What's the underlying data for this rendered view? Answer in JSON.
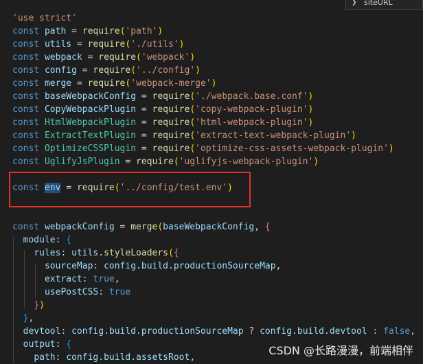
{
  "find_widget": {
    "chevron_icon": "chevron-right-icon",
    "value": "siteURL"
  },
  "code": {
    "l1": {
      "s": "'use strict'"
    },
    "l2": {
      "kw": "const",
      "v": "path",
      "eq": " = ",
      "fn": "require",
      "o": "(",
      "s": "'path'",
      "c": ")"
    },
    "l3": {
      "kw": "const",
      "v": "utils",
      "eq": " = ",
      "fn": "require",
      "o": "(",
      "s": "'./utils'",
      "c": ")"
    },
    "l4": {
      "kw": "const",
      "v": "webpack",
      "eq": " = ",
      "fn": "require",
      "o": "(",
      "s": "'webpack'",
      "c": ")"
    },
    "l5": {
      "kw": "const",
      "v": "config",
      "eq": " = ",
      "fn": "require",
      "o": "(",
      "s": "'../config'",
      "c": ")"
    },
    "l6": {
      "kw": "const",
      "v": "merge",
      "eq": " = ",
      "fn": "require",
      "o": "(",
      "s": "'webpack-merge'",
      "c": ")"
    },
    "l7": {
      "kw": "const",
      "v": "baseWebpackConfig",
      "eq": " = ",
      "fn": "require",
      "o": "(",
      "s": "'./webpack.base.conf'",
      "c": ")"
    },
    "l8": {
      "kw": "const",
      "v": "CopyWebpackPlugin",
      "eq": " = ",
      "fn": "require",
      "o": "(",
      "s": "'copy-webpack-plugin'",
      "c": ")"
    },
    "l9": {
      "kw": "const",
      "v": "HtmlWebpackPlugin",
      "eq": " = ",
      "fn": "require",
      "o": "(",
      "s": "'html-webpack-plugin'",
      "c": ")"
    },
    "l10": {
      "kw": "const",
      "v": "ExtractTextPlugin",
      "eq": " = ",
      "fn": "require",
      "o": "(",
      "s": "'extract-text-webpack-plugin'",
      "c": ")"
    },
    "l11": {
      "kw": "const",
      "v": "OptimizeCSSPlugin",
      "eq": " = ",
      "fn": "require",
      "o": "(",
      "s": "'optimize-css-assets-webpack-plugin'",
      "c": ")"
    },
    "l12": {
      "kw": "const",
      "v": "UglifyJsPlugin",
      "eq": " = ",
      "fn": "require",
      "o": "(",
      "s": "'uglifyjs-webpack-plugin'",
      "c": ")"
    },
    "l14": {
      "kw": "const",
      "v": "env",
      "eq": " = ",
      "fn": "require",
      "o": "(",
      "s": "'../config/test.env'",
      "c": ")"
    },
    "l17": {
      "kw": "const",
      "v": "webpackConfig",
      "eq": " = ",
      "fn": "merge",
      "o": "(",
      "arg": "baseWebpackConfig",
      "comma": ", ",
      "b": "{"
    },
    "l18": {
      "indent": "  ",
      "k": "module",
      "colon": ": ",
      "b": "{"
    },
    "l19": {
      "indent": "    ",
      "k": "rules",
      "colon": ": ",
      "obj": "utils",
      "dot": ".",
      "fn": "styleLoaders",
      "o": "(",
      "b": "{"
    },
    "l20": {
      "indent": "      ",
      "k": "sourceMap",
      "colon": ": ",
      "a": "config",
      "d1": ".",
      "b2": "build",
      "d2": ".",
      "c2": "productionSourceMap",
      "comma": ","
    },
    "l21": {
      "indent": "      ",
      "k": "extract",
      "colon": ": ",
      "val": "true",
      "comma": ","
    },
    "l22": {
      "indent": "      ",
      "k": "usePostCSS",
      "colon": ": ",
      "val": "true"
    },
    "l23": {
      "indent": "    ",
      "b": "}",
      "c": ")"
    },
    "l24": {
      "indent": "  ",
      "b": "}",
      "comma": ","
    },
    "l25": {
      "indent": "  ",
      "k": "devtool",
      "colon": ": ",
      "a": "config",
      "d1": ".",
      "b2": "build",
      "d2": ".",
      "c2": "productionSourceMap",
      "q": " ? ",
      "a2": "config",
      "d3": ".",
      "b3": "build",
      "d4": ".",
      "c3": "devtool",
      "col2": " : ",
      "val": "false",
      "comma": ","
    },
    "l26": {
      "indent": "  ",
      "k": "output",
      "colon": ": ",
      "b": "{"
    },
    "l27": {
      "indent": "    ",
      "k": "path",
      "colon": ": ",
      "a": "config",
      "d1": ".",
      "b2": "build",
      "d2": ".",
      "c2": "assetsRoot",
      "comma": ","
    }
  },
  "watermark": "CSDN @长路漫漫，前端相伴"
}
